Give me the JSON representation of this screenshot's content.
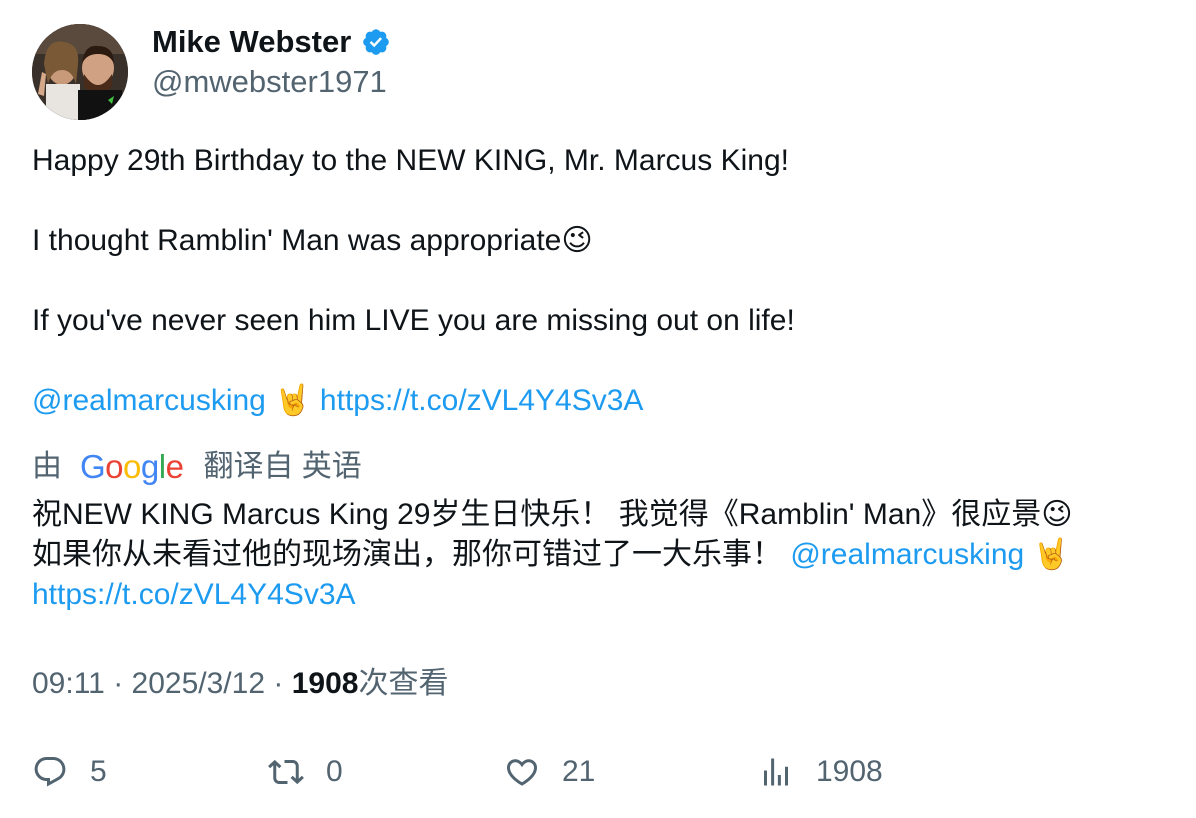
{
  "author": {
    "name": "Mike Webster",
    "handle": "@mwebster1971",
    "verified": true,
    "verified_color": "#1d9bf0"
  },
  "tweet": {
    "line1": "Happy 29th Birthday to the NEW KING, Mr. Marcus King!",
    "line2_text": "I thought Ramblin' Man was appropriate",
    "line2_emoji": "😉",
    "line3": "If you've never seen him LIVE you are missing out on life!",
    "mention": "@realmarcusking",
    "mention_emoji": "🤘",
    "link": "https://t.co/zVL4Y4Sv3A"
  },
  "translation": {
    "prefix": "由",
    "provider": "Google",
    "suffix": "翻译自 英语",
    "text_part1": "祝NEW KING Marcus King 29岁生日快乐！ 我觉得《Ramblin' Man》很应景",
    "emoji1": "😉",
    "text_part2": "如果你从未看过他的现场演出，那你可错过了一大乐事！",
    "mention": "@realmarcusking",
    "emoji2": "🤘",
    "link": "https://t.co/zVL4Y4Sv3A"
  },
  "meta": {
    "time": "09:11",
    "separator": "·",
    "date": "2025/3/12",
    "views_count": "1908",
    "views_label": "次查看"
  },
  "actions": {
    "replies": "5",
    "retweets": "0",
    "likes": "21",
    "views": "1908"
  },
  "colors": {
    "link": "#1d9bf0",
    "secondary_text": "#536471",
    "primary_text": "#0f1419"
  },
  "icons": [
    "verified-badge-icon",
    "reply-icon",
    "retweet-icon",
    "like-icon",
    "views-icon"
  ]
}
